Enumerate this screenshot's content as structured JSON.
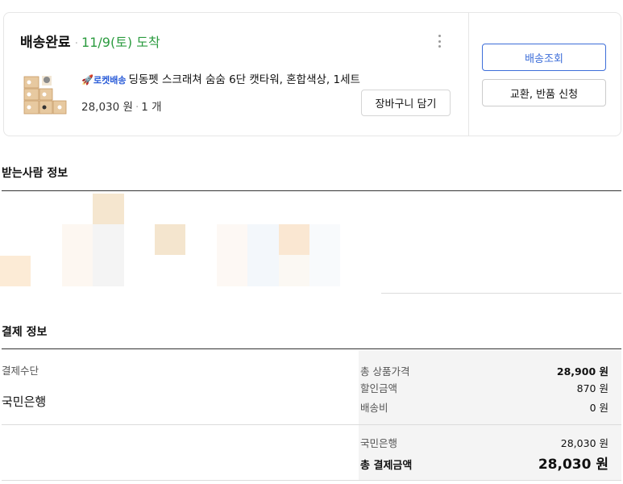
{
  "order": {
    "status": "배송완료",
    "arrival": "11/9(토) 도착",
    "rocket_label": "로켓배송",
    "item_name": "딩동펫 스크래쳐 숨숨 6단 캣타워, 혼합색상, 1세트",
    "price": "28,030 원",
    "quantity": "1 개",
    "cart_button": "장바구니 담기",
    "track_button": "배송조회",
    "return_button": "교환, 반품 신청",
    "rocket_icon": "rocket-icon",
    "more_icon": "more-vertical-icon"
  },
  "recipient": {
    "title": "받는사람 정보"
  },
  "payment": {
    "title": "결제 정보",
    "method_label": "결제수단",
    "method_value": "국민은행",
    "total_product_label": "총 상품가격",
    "total_product_value": "28,900 원",
    "discount_label": "할인금액",
    "discount_value": "870 원",
    "shipping_label": "배송비",
    "shipping_value": "0 원",
    "bank_label": "국민은행",
    "bank_value": "28,030 원",
    "grand_total_label": "총 결제금액",
    "grand_total_value": "28,030 원"
  },
  "colors": {
    "accent_blue": "#3d6ed9",
    "arrival_green": "#2b9b3f"
  }
}
